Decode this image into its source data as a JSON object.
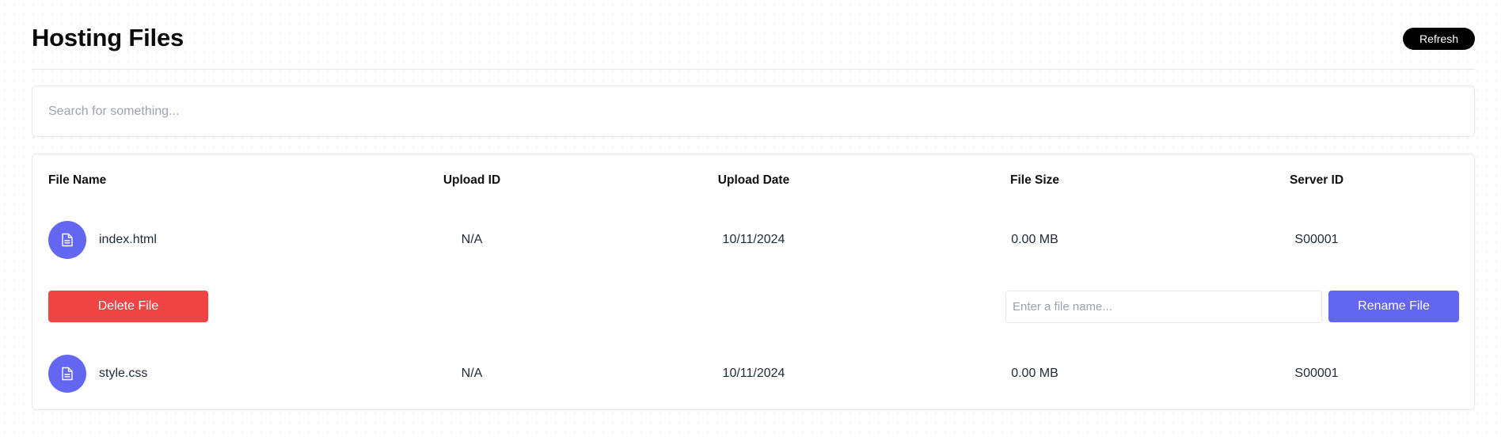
{
  "header": {
    "title": "Hosting Files",
    "refresh_label": "Refresh"
  },
  "search": {
    "placeholder": "Search for something..."
  },
  "table": {
    "columns": [
      "File Name",
      "Upload ID",
      "Upload Date",
      "File Size",
      "Server ID"
    ],
    "rows": [
      {
        "file_name": "index.html",
        "upload_id": "N/A",
        "upload_date": "10/11/2024",
        "file_size": "0.00 MB",
        "server_id": "S00001",
        "icon": "file-document-icon"
      },
      {
        "file_name": "style.css",
        "upload_id": "N/A",
        "upload_date": "10/11/2024",
        "file_size": "0.00 MB",
        "server_id": "S00001",
        "icon": "file-document-icon"
      }
    ]
  },
  "actions": {
    "delete_label": "Delete File",
    "rename_placeholder": "Enter a file name...",
    "rename_label": "Rename File"
  },
  "colors": {
    "accent": "#6366f1",
    "danger": "#ef4444",
    "primary_button": "#000000"
  }
}
